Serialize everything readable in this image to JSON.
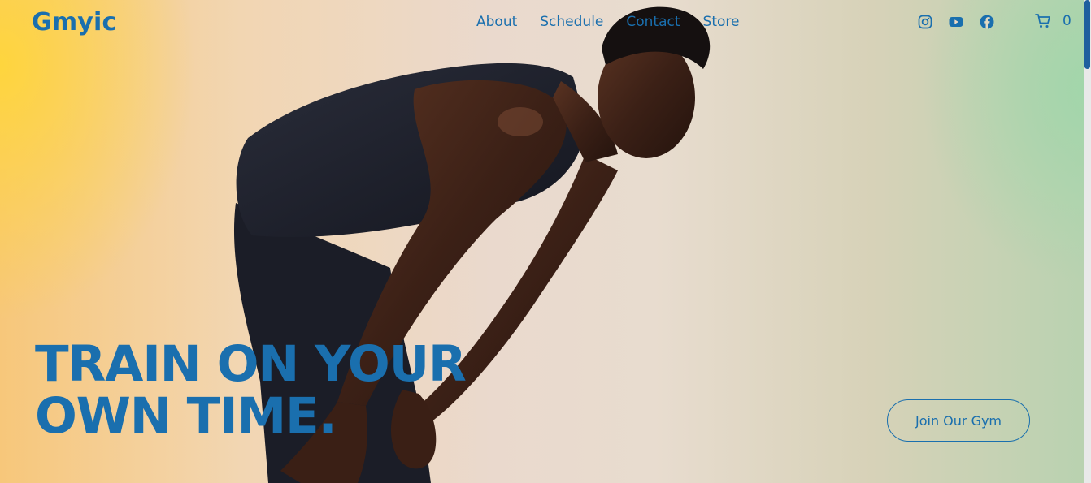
{
  "brand": {
    "logo_text": "Gmyic",
    "color": "#1a6fae"
  },
  "nav": {
    "links": [
      {
        "label": "About"
      },
      {
        "label": "Schedule"
      },
      {
        "label": "Contact"
      },
      {
        "label": "Store"
      }
    ],
    "social": [
      {
        "icon": "instagram-icon"
      },
      {
        "icon": "youtube-icon"
      },
      {
        "icon": "facebook-icon"
      }
    ],
    "cart": {
      "icon": "cart-icon",
      "count": "0"
    }
  },
  "hero": {
    "title_line1": "TRAIN ON YOUR",
    "title_line2": "OWN TIME.",
    "cta_label": "Join Our Gym",
    "image": "athlete-photo"
  }
}
